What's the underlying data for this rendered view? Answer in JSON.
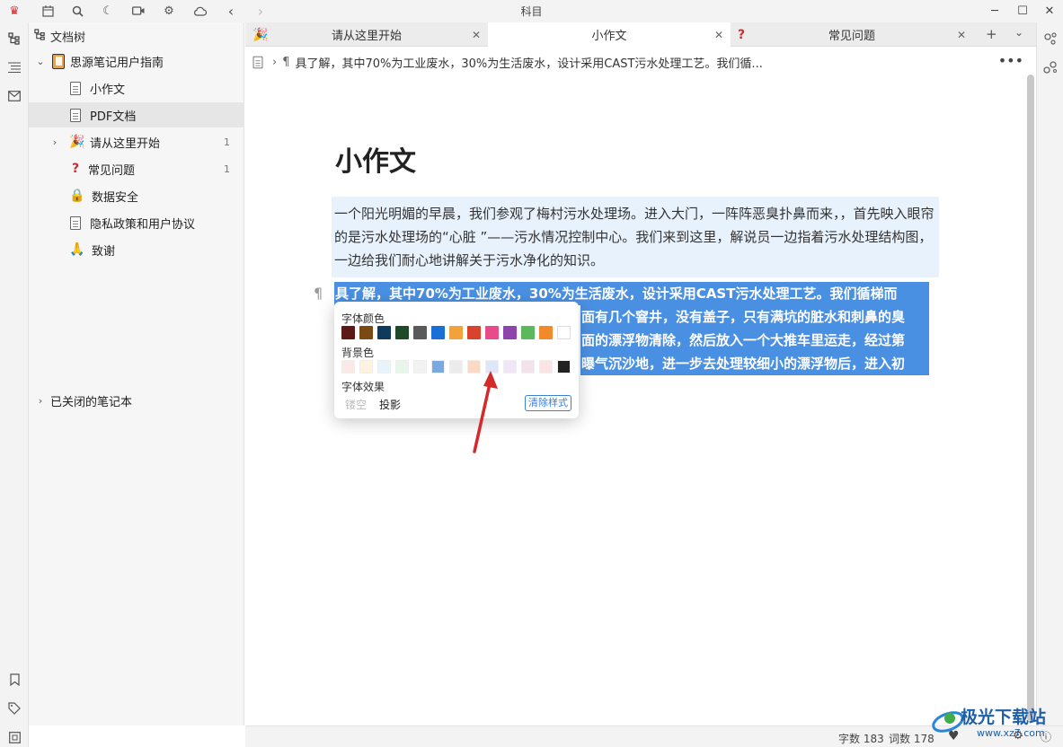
{
  "titlebar": {
    "title": "科目",
    "icons": [
      "crown-icon",
      "calendar-icon",
      "search-icon",
      "moon-icon",
      "video-icon",
      "gear-icon",
      "cloud-icon",
      "back-icon",
      "forward-icon"
    ]
  },
  "sidebar": {
    "header": "文档树",
    "notebook": "思源笔记用户指南",
    "items": [
      {
        "label": "小作文",
        "icon": "document-icon"
      },
      {
        "label": "PDF文档",
        "icon": "document-icon"
      },
      {
        "label": "请从这里开始",
        "icon": "party-icon",
        "count": "1"
      },
      {
        "label": "常见问题",
        "icon": "question-icon",
        "count": "1"
      },
      {
        "label": "数据安全",
        "icon": "lock-icon"
      },
      {
        "label": "隐私政策和用户协议",
        "icon": "document-icon"
      },
      {
        "label": "致谢",
        "icon": "pray-icon"
      }
    ],
    "closed_notebooks": "已关闭的笔记本"
  },
  "tabs": [
    {
      "label": "请从这里开始",
      "icon": "party-icon"
    },
    {
      "label": "小作文"
    },
    {
      "label": "常见问题",
      "icon": "question-icon"
    }
  ],
  "editor": {
    "breadcrumb": "具了解，其中70%为工业废水，30%为生活废水，设计采用CAST污水处理工艺。我们循...",
    "title": "小作文",
    "paragraph1": "一个阳光明媚的早晨，我们参观了梅村污水处理场。进入大门，一阵阵恶臭扑鼻而来，，首先映入眼帘的是污水处理场的“心脏 ”——污水情况控制中心。我们来到这里，解说员一边指着污水处理结构图，一边给我们耐心地讲解关于污水净化的知识。",
    "selected_lines": [
      "具了解，其中70%为工业废水，30%为生活废水，设计采用CAST污水处理工艺。我们循梯而",
      "面有几个窨井，没有盖子，只有满坑的脏水和刺鼻的臭",
      "面的漂浮物清除，然后放入一个大推车里运走，经过第",
      "曝气沉沙地，进一步去处理较细小的漂浮物后，进入初"
    ]
  },
  "popover": {
    "font_color_label": "字体颜色",
    "bg_color_label": "背景色",
    "effect_label": "字体效果",
    "effects": [
      "镂空",
      "投影"
    ],
    "clear_label": "清除样式",
    "font_colors": [
      "#5c1a17",
      "#7a4a12",
      "#103a5c",
      "#1f4a2a",
      "#5a5a5a",
      "#1a6fd6",
      "#f2a23b",
      "#d9432e",
      "#e84b8a",
      "#8e44ad",
      "#5cb85c",
      "#f08a2a",
      "#ffffff"
    ],
    "bg_colors": [
      "#fbe9e7",
      "#fff3e0",
      "#e8f4fc",
      "#e8f5e9",
      "#f2f2f2",
      "#7aa9e0",
      "#ececec",
      "#fbd9c2",
      "#dfe6fb",
      "#efe7f7",
      "#f4e2ea",
      "#fde4e4",
      "#222222"
    ]
  },
  "status": {
    "chars_label": "字数 183",
    "words_label": "词数 178"
  },
  "watermark": {
    "text": "极光下载站",
    "url": "www.xz7.com"
  },
  "colors": {
    "selection": "#4a90e2",
    "para_highlight": "#e8f2fc",
    "accent": "#3b7fd6",
    "arrow": "#d32b2b"
  }
}
